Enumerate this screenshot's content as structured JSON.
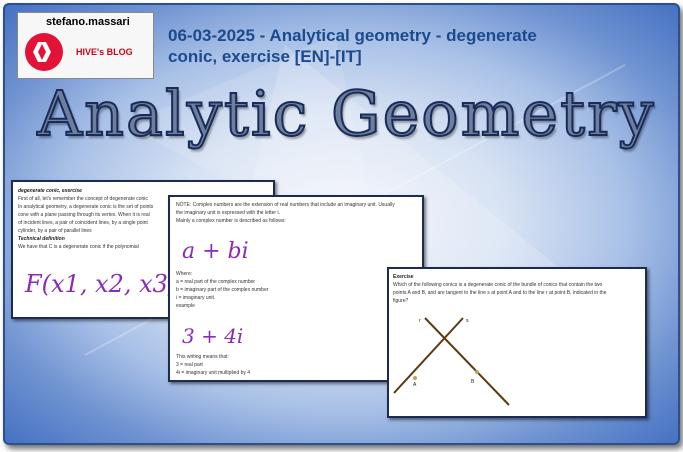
{
  "logo": {
    "username": "stefano.massari",
    "blog_label": "HIVE's BLOG"
  },
  "post": {
    "title_line1": "06-03-2025 - Analytical geometry - degenerate",
    "title_line2": "conic, exercise [EN]-[IT]"
  },
  "banner": {
    "heading": "Analytic Geometry"
  },
  "card1": {
    "heading": "degenerate conic, exercise",
    "lines": [
      "First of all, let's remember the concept of degenerate conic",
      "In analytical geometry, a degenerate conic is the set of points",
      "cone with a plane passing through its vertex. When it is real",
      "of incident lines, a pair of coincident lines, by a single point",
      "cylinder, by a pair of parallel lines"
    ],
    "subheading": "Technical definition",
    "last_line": "We have that C is a degenerate conic if the polynomial",
    "handwriting": "F(x1, x2, x3)"
  },
  "card2": {
    "lines_top": [
      "NOTE: Complex numbers are the extension of real numbers that include an imaginary unit. Usually",
      "the imaginary unit is expressed with the letter i.",
      "Mainly a complex number is described as follows:"
    ],
    "handwriting1": "a + bi",
    "lines_mid": [
      "Where:",
      "a = real part of the complex number",
      "b = imaginary part of the complex number",
      "i = imaginary unit.",
      "example"
    ],
    "handwriting2": "3 + 4i",
    "lines_bottom": [
      "This writing means that:",
      "3 = real part",
      "4i = imaginary unit multiplied by 4"
    ]
  },
  "card3": {
    "heading": "Exercise",
    "lines": [
      "Which of the following conics is a degenerate conic of the bundle of conics that contain the two",
      "points A and B, and are tangent to the line s at point A and to the line r at point B, indicated in the",
      "figure?"
    ],
    "labels": {
      "r": "r",
      "s": "s",
      "a": "A",
      "b": "B"
    }
  },
  "colors": {
    "title_blue": "#1b4b8d",
    "hive_red": "#e31337",
    "frame_blue": "#4671c3",
    "ink_purple": "#8a2bb8",
    "line_brown": "#5a3a12"
  }
}
